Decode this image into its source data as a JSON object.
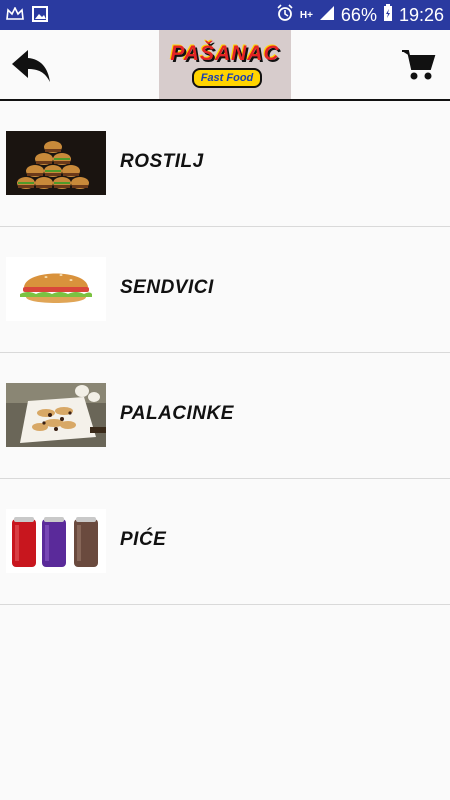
{
  "status_bar": {
    "battery_percent": "66%",
    "time": "19:26",
    "network": "H+",
    "icons": [
      "crown-icon",
      "image-icon",
      "alarm-icon",
      "signal-icon",
      "battery-icon"
    ]
  },
  "toolbar": {
    "back_icon": "back-arrow-icon",
    "logo_text": "PAŠANAC",
    "logo_tagline": "Fast Food",
    "cart_icon": "cart-icon"
  },
  "categories": [
    {
      "label": "ROSTILJ",
      "image": "burger-stack-image"
    },
    {
      "label": "SENDVICI",
      "image": "sandwich-image"
    },
    {
      "label": "PALACINKE",
      "image": "pancakes-image"
    },
    {
      "label": "PIĆE",
      "image": "drink-cans-image"
    }
  ],
  "colors": {
    "status_bar": "#2a3aa0",
    "logo_bg": "#d7cccc",
    "divider": "#d9d9d9"
  }
}
